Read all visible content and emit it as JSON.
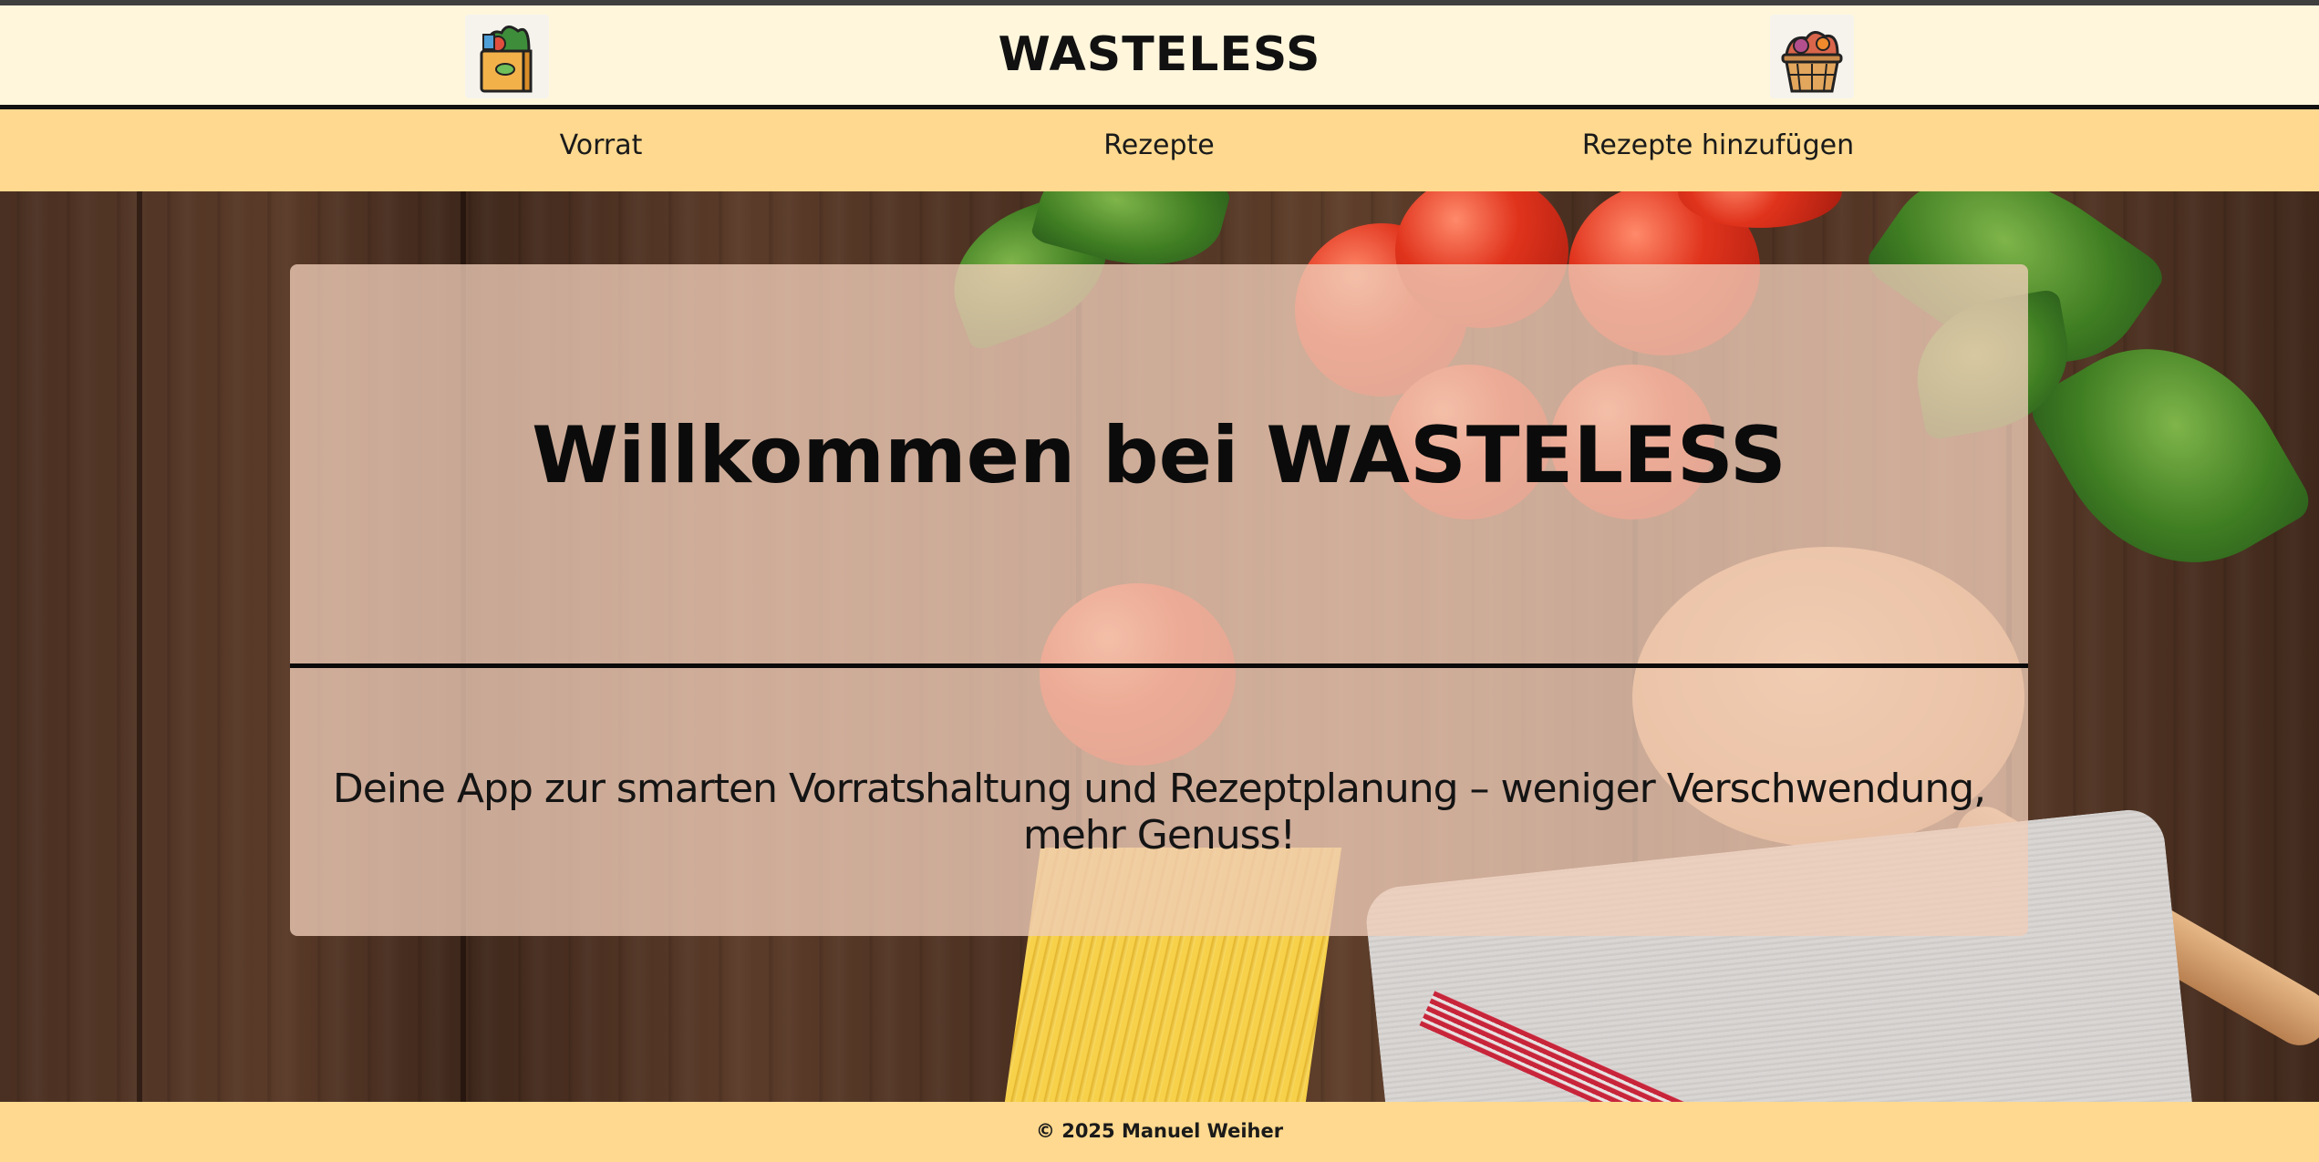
{
  "header": {
    "title": "WASTELESS",
    "left_icon": "grocery-bag-icon",
    "right_icon": "food-basket-icon"
  },
  "nav": {
    "items": [
      {
        "label": "Vorrat"
      },
      {
        "label": "Rezepte"
      },
      {
        "label": "Rezepte hinzufügen"
      }
    ]
  },
  "hero": {
    "title": "Willkommen bei WASTELESS",
    "subtitle": "Deine App zur smarten Vorratshaltung und Rezeptplanung – weniger Verschwendung, mehr Genuss!"
  },
  "footer": {
    "text": "© 2025 Manuel Weiher"
  },
  "colors": {
    "header_bg": "#fff6dc",
    "nav_bg": "#fed98f",
    "footer_bg": "#fed98f",
    "panel_bg": "#f0cdb9",
    "text": "#111111"
  }
}
